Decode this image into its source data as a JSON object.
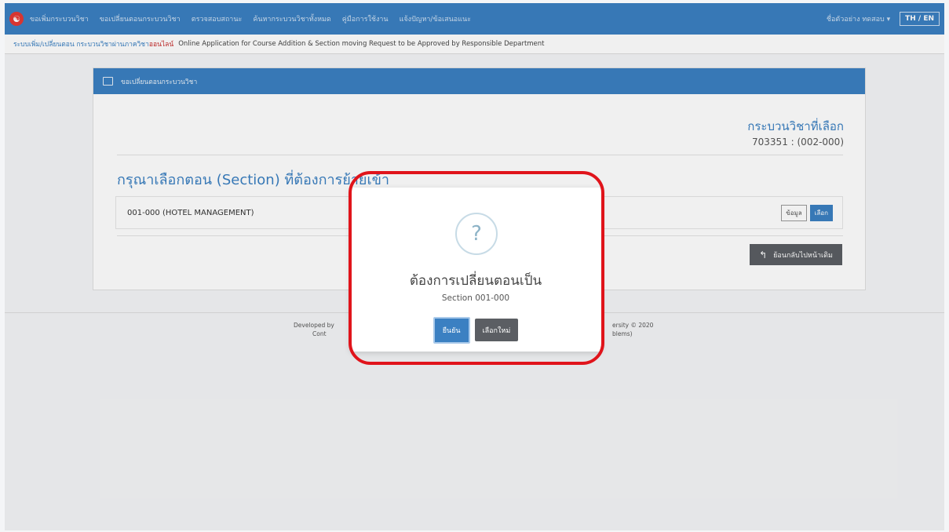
{
  "nav": {
    "items": [
      "ขอเพิ่มกระบวนวิชา",
      "ขอเปลี่ยนตอนกระบวนวิชา",
      "ตรวจสอบสถานะ",
      "ค้นหากระบวนวิชาทั้งหมด",
      "คู่มือการใช้งาน",
      "แจ้งปัญหา/ข้อเสนอแนะ"
    ],
    "user": "ชื่อตัวอย่าง ทดสอบ ▾",
    "lang": "TH / EN"
  },
  "subheader": {
    "th_part1": "ระบบเพิ่ม/เปลี่ยนตอน กระบวนวิชาผ่านภาควิชา",
    "th_part2": "ออนไลน์",
    "en": "Online Application for Course Addition & Section moving Request to be Approved by Responsible Department"
  },
  "card": {
    "header": "ขอเปลี่ยนตอนกระบวนวิชา",
    "selected_title": "กระบวนวิชาที่เลือก",
    "selected_code": "703351 : (002-000)",
    "choose_heading": "กรุณาเลือกตอน (Section) ที่ต้องการย้ายเข้า",
    "section_row": "001-000 (HOTEL MANAGEMENT)",
    "info_button": "ข้อมูล",
    "select_button": "เลือก",
    "back_button": "ย้อนกลับไปหน้าเดิม"
  },
  "footer": {
    "line1_left": "Developed by",
    "line1_right": "ersity © 2020",
    "line2_left": "Cont",
    "line2_right": "blems)"
  },
  "modal": {
    "title": "ต้องการเปลี่ยนตอนเป็น",
    "subtitle": "Section 001-000",
    "confirm": "ยืนยัน",
    "cancel": "เลือกใหม่"
  },
  "colors": {
    "primary": "#3b80c2",
    "highlight": "#e0141b",
    "dark_button": "#5b5e63"
  }
}
